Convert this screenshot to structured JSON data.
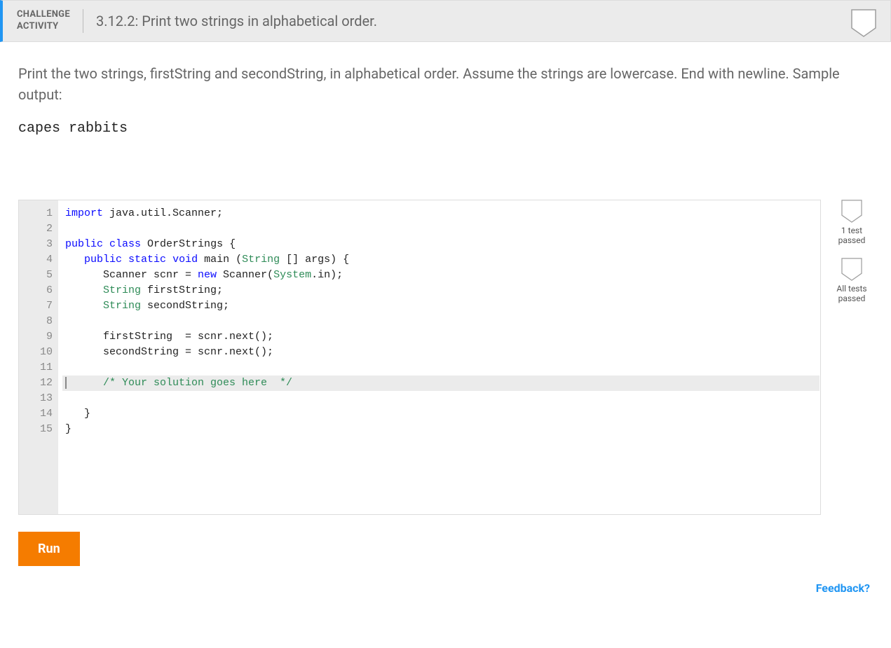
{
  "header": {
    "label_line1": "CHALLENGE",
    "label_line2": "ACTIVITY",
    "title": "3.12.2: Print two strings in alphabetical order."
  },
  "instructions": "Print the two strings, firstString and secondString, in alphabetical order. Assume the strings are lowercase. End with newline. Sample output:",
  "sample_output": "capes rabbits",
  "code": {
    "active_line": 12,
    "lines": [
      {
        "n": 1,
        "tokens": [
          {
            "t": "import",
            "c": "kw"
          },
          {
            "t": " java.util.Scanner;",
            "c": "pln"
          }
        ]
      },
      {
        "n": 2,
        "tokens": []
      },
      {
        "n": 3,
        "tokens": [
          {
            "t": "public",
            "c": "kw"
          },
          {
            "t": " ",
            "c": "pln"
          },
          {
            "t": "class",
            "c": "kw"
          },
          {
            "t": " OrderStrings {",
            "c": "pln"
          }
        ]
      },
      {
        "n": 4,
        "tokens": [
          {
            "t": "   ",
            "c": "pln"
          },
          {
            "t": "public",
            "c": "kw"
          },
          {
            "t": " ",
            "c": "pln"
          },
          {
            "t": "static",
            "c": "kw"
          },
          {
            "t": " ",
            "c": "pln"
          },
          {
            "t": "void",
            "c": "kw"
          },
          {
            "t": " main (",
            "c": "pln"
          },
          {
            "t": "String",
            "c": "cls"
          },
          {
            "t": " [] args) {",
            "c": "pln"
          }
        ]
      },
      {
        "n": 5,
        "tokens": [
          {
            "t": "      Scanner scnr = ",
            "c": "pln"
          },
          {
            "t": "new",
            "c": "kw"
          },
          {
            "t": " Scanner(",
            "c": "pln"
          },
          {
            "t": "System",
            "c": "cls"
          },
          {
            "t": ".in);",
            "c": "pln"
          }
        ]
      },
      {
        "n": 6,
        "tokens": [
          {
            "t": "      ",
            "c": "pln"
          },
          {
            "t": "String",
            "c": "cls"
          },
          {
            "t": " firstString;",
            "c": "pln"
          }
        ]
      },
      {
        "n": 7,
        "tokens": [
          {
            "t": "      ",
            "c": "pln"
          },
          {
            "t": "String",
            "c": "cls"
          },
          {
            "t": " secondString;",
            "c": "pln"
          }
        ]
      },
      {
        "n": 8,
        "tokens": []
      },
      {
        "n": 9,
        "tokens": [
          {
            "t": "      firstString  = scnr.next();",
            "c": "pln"
          }
        ]
      },
      {
        "n": 10,
        "tokens": [
          {
            "t": "      secondString = scnr.next();",
            "c": "pln"
          }
        ]
      },
      {
        "n": 11,
        "tokens": []
      },
      {
        "n": 12,
        "tokens": [
          {
            "t": "      ",
            "c": "pln"
          },
          {
            "t": "/* Your solution goes here  */",
            "c": "cmt"
          }
        ]
      },
      {
        "n": 13,
        "tokens": []
      },
      {
        "n": 14,
        "tokens": [
          {
            "t": "   }",
            "c": "pln"
          }
        ]
      },
      {
        "n": 15,
        "tokens": [
          {
            "t": "}",
            "c": "pln"
          }
        ]
      }
    ]
  },
  "results": [
    {
      "line1": "1 test",
      "line2": "passed"
    },
    {
      "line1": "All tests",
      "line2": "passed"
    }
  ],
  "run_label": "Run",
  "feedback_label": "Feedback?"
}
